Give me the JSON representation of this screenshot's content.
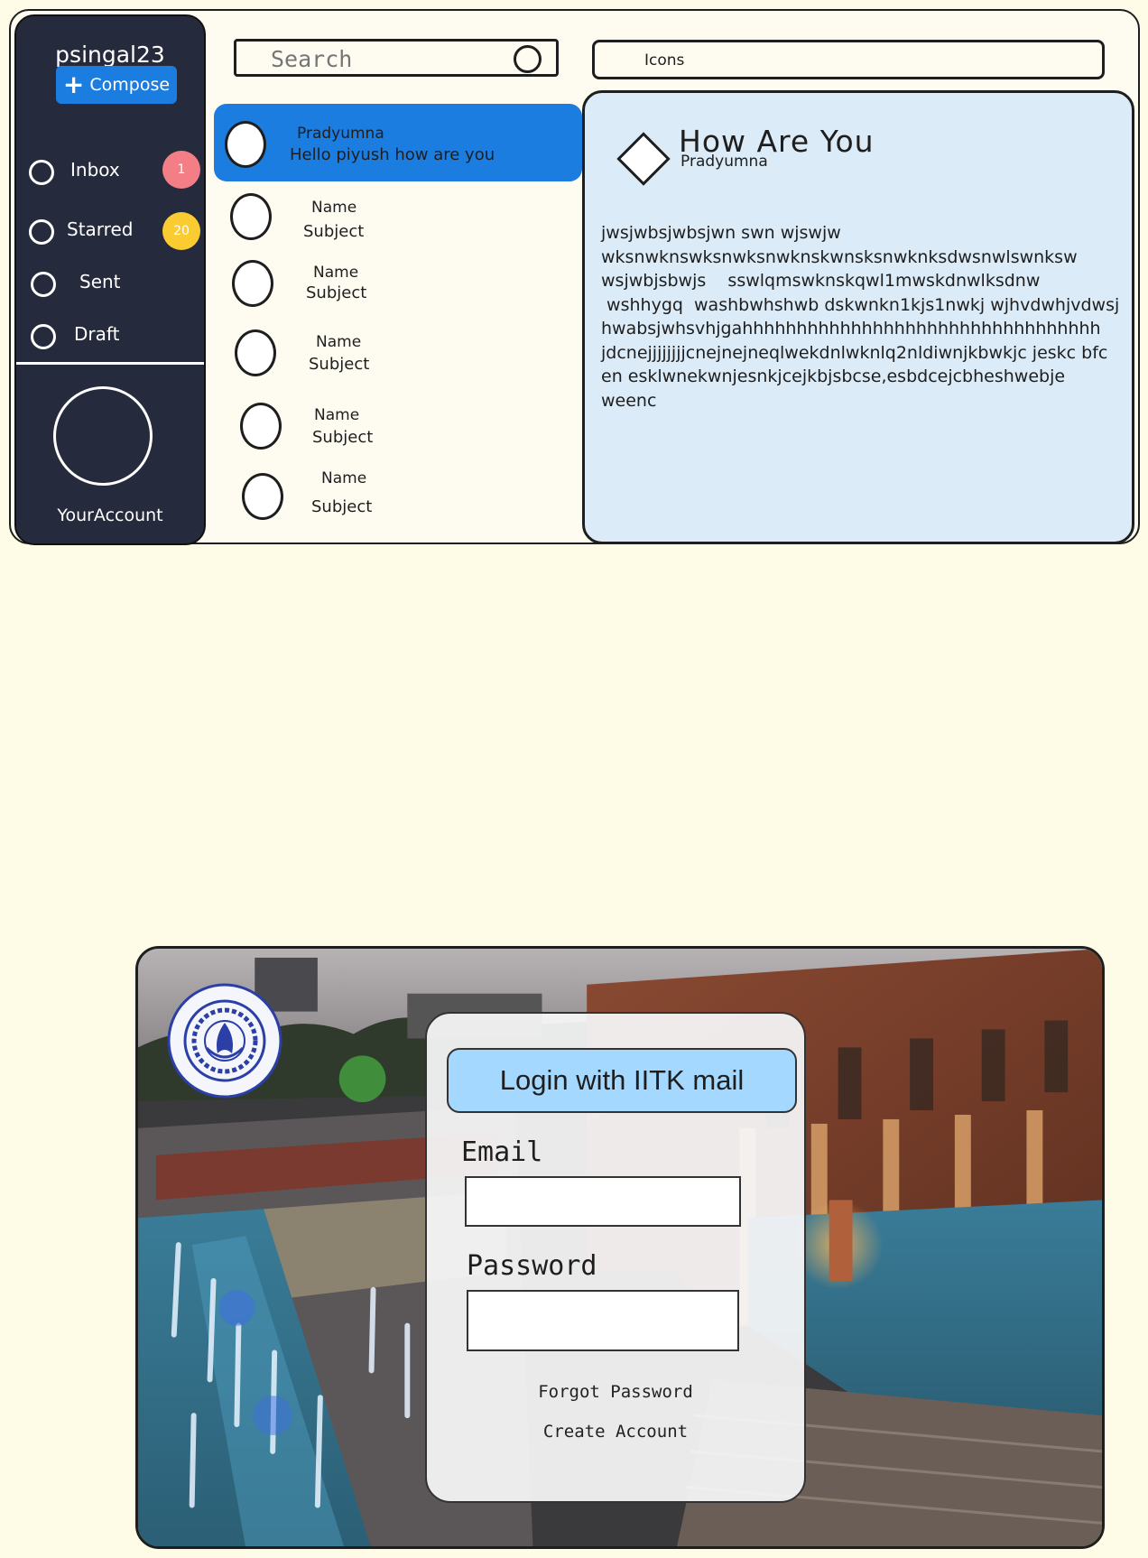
{
  "mail": {
    "username": "psingal23",
    "compose_label": "Compose",
    "nav": [
      {
        "label": "Inbox",
        "badge": "1"
      },
      {
        "label": "Starred",
        "badge": "20"
      },
      {
        "label": "Sent"
      },
      {
        "label": "Draft"
      }
    ],
    "account_label": "YourAccount",
    "search_placeholder": "Search",
    "icons_label": "Icons",
    "messages": [
      {
        "name": "Pradyumna",
        "subject": "Hello piyush how are you"
      },
      {
        "name": "Name",
        "subject": "Subject"
      },
      {
        "name": "Name",
        "subject": "Subject"
      },
      {
        "name": "Name",
        "subject": "Subject"
      },
      {
        "name": "Name",
        "subject": "Subject"
      },
      {
        "name": "Name",
        "subject": "Subject"
      }
    ],
    "open_email": {
      "title": "How Are  You",
      "from": "Pradyumna",
      "body": "jwsjwbsjwbsjwn swn wjswjw\nwksnwknswksnwksnwknskwnsksnwknksdwsnwlswnksw\nwsjwbjsbwjs    sswlqmswknskqwl1mwskdnwlksdnw\n wshhygq  washbwhshwb dskwnkn1kjs1nwkj wjhvdwhjvdwsj\nhwabsjwhsvhjgahhhhhhhhhhhhhhhhhhhhhhhhhhhhhhhhh\njdcnejjjjjjjjcnejnejneqlwekdnlwknlq2nldiwnjkbwkjc jeskc bfc\nen esklwnekwnjesnkjcejkbjsbcse,esbdcejcbheshwebje\nweenc"
    }
  },
  "login": {
    "header": "Login with IITK mail",
    "email_label": "Email",
    "email_value": "",
    "password_label": "Password",
    "password_value": "",
    "forgot_label": "Forgot Password",
    "create_label": "Create Account",
    "logo_icon": "iitk-logo-icon"
  },
  "colors": {
    "page_bg": "#fefbe6",
    "sidebar_bg": "#252a3c",
    "accent_blue": "#1c7de0",
    "reading_pane_bg": "#dbebf8",
    "login_header_bg": "#a5d8ff",
    "badge_red": "#f37e86",
    "badge_yellow": "#fbcc31"
  }
}
